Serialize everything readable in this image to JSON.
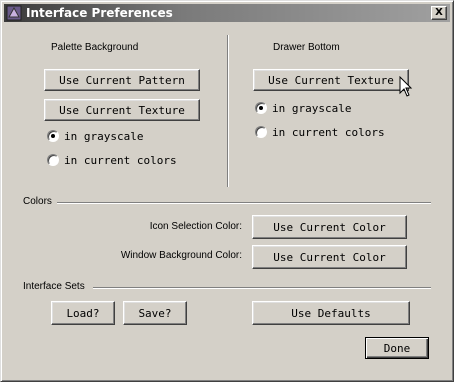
{
  "window": {
    "title": "Interface Preferences",
    "close_label": "X"
  },
  "palette_background": {
    "heading": "Palette Background",
    "use_pattern_label": "Use Current Pattern",
    "use_texture_label": "Use Current Texture",
    "options": [
      "in grayscale",
      "in current colors"
    ],
    "selected": "in grayscale"
  },
  "drawer_bottom": {
    "heading": "Drawer Bottom",
    "use_texture_label": "Use Current Texture",
    "options": [
      "in grayscale",
      "in current colors"
    ],
    "selected": "in grayscale"
  },
  "colors": {
    "heading": "Colors",
    "icon_selection_label": "Icon Selection Color:",
    "icon_selection_button": "Use Current Color",
    "window_background_label": "Window Background Color:",
    "window_background_button": "Use Current Color"
  },
  "interface_sets": {
    "heading": "Interface Sets",
    "load_label": "Load?",
    "save_label": "Save?",
    "defaults_label": "Use Defaults"
  },
  "footer": {
    "done_label": "Done"
  },
  "icons": {
    "app": "app-icon",
    "close": "close-icon",
    "cursor": "mouse-pointer-icon"
  }
}
